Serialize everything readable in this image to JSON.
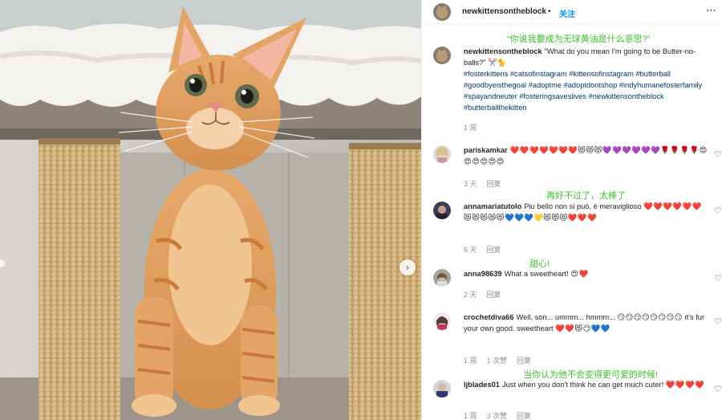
{
  "post": {
    "username": "newkittensontheblock",
    "follow_label": "关注",
    "separator": "•",
    "more_icon": "⋯",
    "caption_cn": "“你说我要成为无球黄油是什么意思?”",
    "caption_text": "\"What do you mean I'm going to be Butter-no-balls?\" ✂️🐈",
    "hashtags": "#fosterkittens #catsofinstagram #kittensofinstagram #butterball #goodbyeisthegoal #adoptme #adoptdontshop #indyhumanefosterfamily #spayandneuter #fosteringsaveslives #newkittensontheblock #butterballthekitten",
    "time": "1 周"
  },
  "comments": [
    {
      "username": "pariskamkar",
      "text": "",
      "emojis": "❤️❤️❤️❤️❤️❤️❤️😻😻😻💜💜💜💜💜💜🌹🌹🌹🌹😍😍😍😍😍😍",
      "time": "3 天",
      "reply": "回复",
      "likes": "",
      "cn": ""
    },
    {
      "username": "annamariatutolo",
      "text": "Piu bello non si può, è meraviglioso",
      "emojis": "❤️❤️❤️❤️❤️❤️😻😻😻😻😻💙💙💙💛😻😻😻❤️❤️❤️",
      "time": "6 天",
      "reply": "回复",
      "likes": "",
      "cn": "再好不过了，太棒了"
    },
    {
      "username": "anna98639",
      "text": "What a sweetheart!",
      "emojis": "😍❤️",
      "time": "2 天",
      "reply": "回复",
      "likes": "",
      "cn": "甜心!"
    },
    {
      "username": "crochetdiva66",
      "text": "Well, son... ummm... hmmm...",
      "emojis": "😏😏😏😏😏😏😏😏",
      "text2": "it's fur your own good. sweetheart",
      "emojis2": "❤️❤️😻😏💙💙",
      "time": "1 周",
      "reply": "回复",
      "likes": "1 次赞",
      "cn": ""
    },
    {
      "username": "ljblades01",
      "text": "Just when you don't think he can get much cuter!",
      "emojis": "❤️❤️❤️❤️",
      "time": "1 周",
      "reply": "回复",
      "likes": "3 次赞",
      "cn": "当你认为他不会变得更可爱的时候!"
    }
  ],
  "icons": {
    "heart": "♡",
    "next": "›"
  }
}
